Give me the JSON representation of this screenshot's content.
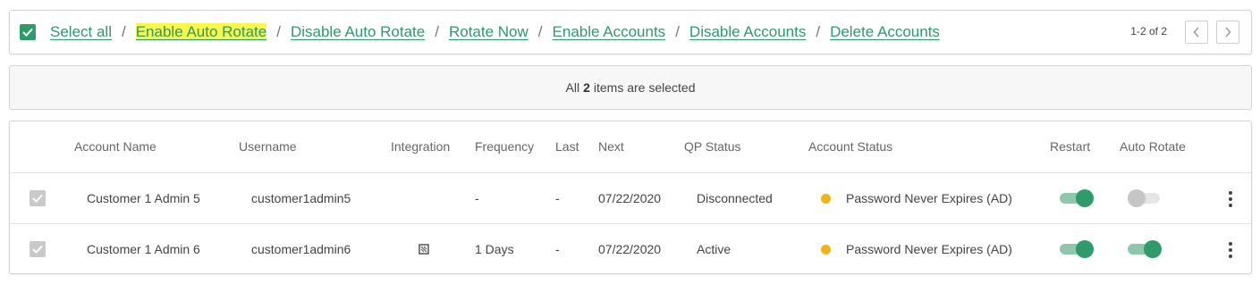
{
  "toolbar": {
    "actions": [
      "Select all",
      "Enable Auto Rotate",
      "Disable Auto Rotate",
      "Rotate Now",
      "Enable Accounts",
      "Disable Accounts",
      "Delete Accounts"
    ],
    "separator": "/",
    "pagination": "1-2 of 2"
  },
  "banner": {
    "prefix": "All",
    "count": "2",
    "suffix": "items are selected"
  },
  "table": {
    "headers": {
      "account_name": "Account Name",
      "username": "Username",
      "integration": "Integration",
      "frequency": "Frequency",
      "last": "Last",
      "next": "Next",
      "qp_status": "QP Status",
      "account_status": "Account Status",
      "restart": "Restart",
      "auto_rotate": "Auto Rotate"
    },
    "rows": [
      {
        "account_name": "Customer 1 Admin 5",
        "username": "customer1admin5",
        "integration": "",
        "frequency": "-",
        "last": "-",
        "next": "07/22/2020",
        "qp_status": "Disconnected",
        "account_status": "Password Never Expires (AD)",
        "restart": "on",
        "auto_rotate": "off"
      },
      {
        "account_name": "Customer 1 Admin 6",
        "username": "customer1admin6",
        "integration": "integration-icon",
        "frequency": "1 Days",
        "last": "-",
        "next": "07/22/2020",
        "qp_status": "Active",
        "account_status": "Password Never Expires (AD)",
        "restart": "on",
        "auto_rotate": "on"
      }
    ]
  },
  "colors": {
    "accent": "#2f9a6a",
    "highlight": "#f9f74a",
    "status_dot": "#f0b41a"
  }
}
